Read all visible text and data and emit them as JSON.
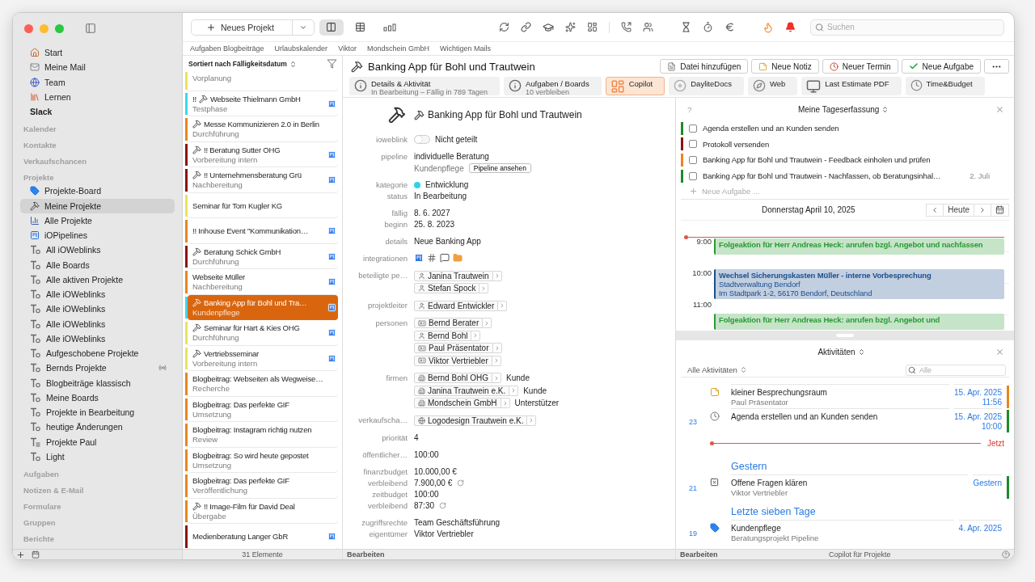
{
  "sidebar": {
    "top_items": [
      {
        "kind": "home",
        "label": "Start"
      },
      {
        "kind": "mail",
        "label": "Meine Mail"
      },
      {
        "kind": "globe",
        "label": "Team"
      },
      {
        "kind": "books",
        "label": "Lernen"
      },
      {
        "kind": "group",
        "label": "Slack"
      }
    ],
    "sections": [
      {
        "title": "Kalender"
      },
      {
        "title": "Kontakte"
      },
      {
        "title": "Verkaufschancen"
      },
      {
        "title": "Projekte",
        "items": [
          {
            "kind": "tag",
            "label": "Projekte-Board",
            "selected": false,
            "shared": false
          },
          {
            "kind": "hammer",
            "label": "Meine Projekte",
            "selected": true,
            "shared": false
          },
          {
            "kind": "chart",
            "label": "Alle Projekte",
            "selected": false,
            "shared": false
          },
          {
            "kind": "pipeline",
            "label": "iOPipelines",
            "selected": false,
            "shared": false
          },
          {
            "kind": "smartlist",
            "label": "All iOWeblinks",
            "selected": false,
            "shared": false
          },
          {
            "kind": "smartlist",
            "label": "Alle Boards",
            "selected": false,
            "shared": false
          },
          {
            "kind": "smartlist",
            "label": "Alle aktiven Projekte",
            "selected": false,
            "shared": false
          },
          {
            "kind": "smartlist",
            "label": "Alle iOWeblinks",
            "selected": false,
            "shared": false
          },
          {
            "kind": "smartlist",
            "label": "Alle iOWeblinks",
            "selected": false,
            "shared": false
          },
          {
            "kind": "smartlist",
            "label": "Alle iOWeblinks",
            "selected": false,
            "shared": false
          },
          {
            "kind": "smartlist",
            "label": "Alle iOWeblinks",
            "selected": false,
            "shared": false
          },
          {
            "kind": "smartlist",
            "label": "Aufgeschobene Projekte",
            "selected": false,
            "shared": false
          },
          {
            "kind": "smartlist",
            "label": "Bernds Projekte",
            "selected": false,
            "shared": true
          },
          {
            "kind": "smartlist",
            "label": "Blogbeiträge klassisch",
            "selected": false,
            "shared": false
          },
          {
            "kind": "smartlist",
            "label": "Meine Boards",
            "selected": false,
            "shared": false
          },
          {
            "kind": "smartlist",
            "label": "Projekte in Bearbeitung",
            "selected": false,
            "shared": false
          },
          {
            "kind": "smartlist",
            "label": "heutige Änderungen",
            "selected": false,
            "shared": false
          },
          {
            "kind": "list",
            "label": "Projekte Paul",
            "selected": false,
            "shared": false
          },
          {
            "kind": "smartlist",
            "label": "Light",
            "selected": false,
            "shared": false
          }
        ]
      },
      {
        "title": "Aufgaben"
      },
      {
        "title": "Notizen & E-Mail"
      },
      {
        "title": "Formulare"
      },
      {
        "title": "Gruppen"
      },
      {
        "title": "Berichte"
      }
    ]
  },
  "toolbar": {
    "new_button": "Neues Projekt",
    "views": [
      {
        "kind": "columns",
        "selected": true
      },
      {
        "kind": "table",
        "selected": false
      },
      {
        "kind": "board",
        "selected": false
      }
    ],
    "search": {
      "placeholder": "Suchen"
    }
  },
  "favorites": [
    "Aufgaben Blogbeiträge",
    "Urlaubskalender",
    "Viktor",
    "Mondschein GmbH",
    "Wichtigen Mails"
  ],
  "list": {
    "sort": "Sortiert nach Fälligkeitsdatum",
    "footer": "31 Elemente",
    "rows": [
      {
        "subtitle": "Vorplanung",
        "color": "#e9e35c",
        "hammer": false,
        "board": false,
        "selected": false
      },
      {
        "prefix": "!!",
        "title": "Webseite Thielmann GmbH",
        "subtitle": "Testphase",
        "color": "#3bd8ea",
        "hammer": true,
        "board": true,
        "selected": false
      },
      {
        "title": "Messe Kommunizieren 2.0 in Berlin",
        "subtitle": "Durchführung",
        "color": "#e8861c",
        "hammer": true,
        "board": false,
        "selected": false
      },
      {
        "title": "!! Beratung Sutter OHG",
        "subtitle": "Vorbereitung intern",
        "color": "#8a1414",
        "hammer": true,
        "board": true,
        "selected": false
      },
      {
        "title": "!! Unternehmensberatung Grü",
        "subtitle": "Nachbereitung",
        "color": "#8a1414",
        "hammer": true,
        "board": true,
        "selected": false
      },
      {
        "title": "Seminar für Tom Kugler KG",
        "color": "#e9e35c",
        "hammer": false,
        "board": false,
        "selected": false
      },
      {
        "title": "!! Inhouse Event \"Kommunikation…",
        "color": "#e8861c",
        "hammer": false,
        "board": true,
        "selected": false
      },
      {
        "title": "Beratung Schick GmbH",
        "subtitle": "Durchführung",
        "color": "#8a1414",
        "hammer": true,
        "board": true,
        "selected": false
      },
      {
        "title": "Webseite Müller",
        "subtitle": "Nachbereitung",
        "color": "#e8861c",
        "hammer": false,
        "board": true,
        "selected": false
      },
      {
        "title": "Banking App für Bohl und Tra…",
        "subtitle": "Kundenpflege",
        "color": "#3bd8ea",
        "hammer": true,
        "board": true,
        "selected": true
      },
      {
        "title": "Seminar für Hart & Kies OHG",
        "subtitle": "Durchführung",
        "color": "#e9e35c",
        "hammer": true,
        "board": true,
        "selected": false
      },
      {
        "title": "Vertriebsseminar",
        "subtitle": "Vorbereitung intern",
        "color": "#e9e35c",
        "hammer": true,
        "board": true,
        "selected": false
      },
      {
        "title": "Blogbeitrag: Webseiten als Wegweise…",
        "subtitle": "Recherche",
        "color": "#e8861c",
        "hammer": false,
        "board": false,
        "selected": false
      },
      {
        "title": "Blogbeitrag: Das perfekte GIF",
        "subtitle": "Umsetzung",
        "color": "#e8861c",
        "hammer": false,
        "board": false,
        "selected": false
      },
      {
        "title": "Blogbeitrag: Instagram richtig nutzen",
        "subtitle": "Review",
        "color": "#e8861c",
        "hammer": false,
        "board": false,
        "selected": false
      },
      {
        "title": "Blogbeitrag: So wird heute gepostet",
        "subtitle": "Umsetzung",
        "color": "#e8861c",
        "hammer": false,
        "board": false,
        "selected": false
      },
      {
        "title": "Blogbeitrag: Das perfekte GIF",
        "subtitle": "Veröffentlichung",
        "color": "#e8861c",
        "hammer": false,
        "board": false,
        "selected": false
      },
      {
        "title": "!! Image-Film für David Deal",
        "subtitle": "Übergabe",
        "color": "#e8861c",
        "hammer": true,
        "board": false,
        "selected": false
      },
      {
        "title": "Medienberatung Langer GbR",
        "color": "#8a1414",
        "hammer": false,
        "board": true,
        "selected": false
      }
    ]
  },
  "project": {
    "title": "Banking App für Bohl und Trautwein",
    "actions": [
      {
        "kind": "file",
        "label": "Datei hinzufügen"
      },
      {
        "kind": "note",
        "label": "Neue Notiz"
      },
      {
        "kind": "event",
        "label": "Neuer Termin"
      },
      {
        "kind": "task",
        "label": "Neue Aufgabe"
      },
      {
        "kind": "more"
      }
    ],
    "tabs": [
      {
        "kind": "info",
        "title": "Details & Aktivität",
        "subtitle": "In Bearbeitung – Fällig in 789 Tagen",
        "selected": false
      },
      {
        "kind": "info",
        "title": "Aufgaben / Boards",
        "subtitle": "10 verbleiben",
        "selected": false
      },
      {
        "kind": "copilot",
        "title": "Copilot",
        "selected": true
      },
      {
        "kind": "docs",
        "title": "DayliteDocs",
        "selected": false
      },
      {
        "kind": "web",
        "title": "Web",
        "selected": false
      },
      {
        "kind": "pdf",
        "title": "Last Estimate PDF",
        "selected": false
      },
      {
        "kind": "time",
        "title": "Time&Budget",
        "selected": false
      }
    ]
  },
  "detail": {
    "heading": "Banking App für Bohl und Trautwein",
    "footer": "Bearbeiten",
    "groups": [
      [
        {
          "kind": "toggle",
          "label": "ioweblink",
          "on": false,
          "value": "Nicht geteilt"
        }
      ],
      [
        {
          "kind": "pipeline",
          "label": "pipeline",
          "value": "individuelle Beratung",
          "sub": "Kundenpflege",
          "button": "Pipeline ansehen"
        }
      ],
      [
        {
          "kind": "category",
          "label": "kategorie",
          "value": "Entwicklung",
          "color": "#2ed3e6"
        },
        {
          "kind": "text",
          "label": "status",
          "value": "In Bearbeitung"
        }
      ],
      [
        {
          "kind": "text",
          "label": "fällig",
          "value": "8. 6. 2027"
        },
        {
          "kind": "text",
          "label": "beginn",
          "value": "25. 8. 2023"
        }
      ],
      [
        {
          "kind": "text",
          "label": "details",
          "value": "Neue Banking App"
        }
      ],
      [
        {
          "kind": "integrations",
          "label": "integrationen"
        }
      ],
      [
        {
          "kind": "chips",
          "label": "beteiligte pe…",
          "chips": [
            {
              "kind": "person",
              "text": "Janina Trautwein"
            },
            {
              "kind": "person",
              "text": "Stefan Spock"
            }
          ]
        }
      ],
      [
        {
          "kind": "chips",
          "label": "projektleiter",
          "chips": [
            {
              "kind": "person",
              "text": "Edward Entwickler"
            }
          ]
        }
      ],
      [
        {
          "kind": "chips",
          "label": "personen",
          "chips": [
            {
              "kind": "card",
              "text": "Bernd Berater"
            },
            {
              "kind": "person",
              "text": "Bernd Bohl"
            },
            {
              "kind": "card",
              "text": "Paul Präsentator"
            },
            {
              "kind": "card",
              "text": "Viktor Vertriebler"
            }
          ]
        }
      ],
      [
        {
          "kind": "chips",
          "label": "firmen",
          "chips": [
            {
              "kind": "company",
              "text": "Bernd Bohl OHG",
              "role": "Kunde"
            },
            {
              "kind": "company",
              "text": "Janina Trautwein e.K.",
              "role": "Kunde"
            },
            {
              "kind": "company",
              "text": "Mondschein GmbH",
              "role": "Unterstützer"
            }
          ]
        }
      ],
      [
        {
          "kind": "chips",
          "label": "verkaufscha…",
          "chips": [
            {
              "kind": "opportunity",
              "text": "Logodesign Trautwein e.K."
            }
          ]
        }
      ],
      [
        {
          "kind": "text",
          "label": "priorität",
          "value": "4"
        }
      ],
      [
        {
          "kind": "text",
          "label": "öffentlicher…",
          "value": "100:00"
        }
      ],
      [
        {
          "kind": "text",
          "label": "finanzbudget",
          "value": "10.000,00 €"
        },
        {
          "kind": "remaining",
          "label": "verbleibend",
          "value": "7.900,00 €"
        },
        {
          "kind": "text",
          "label": "zeitbudget",
          "value": "100:00"
        },
        {
          "kind": "remaining",
          "label": "verbleibend",
          "value": "87:30"
        }
      ],
      [
        {
          "kind": "text",
          "label": "zugriffsrechte",
          "value": "Team Geschäftsführung"
        },
        {
          "kind": "text",
          "label": "eigentümer",
          "value": "Viktor Vertriebler"
        }
      ]
    ]
  },
  "day_summary": {
    "help": "?",
    "title": "Meine Tageserfassung",
    "add": "Neue Aufgabe …",
    "tasks": [
      {
        "text": "Agenda erstellen und an Kunden senden",
        "color": "#1e8a2a",
        "checked": false
      },
      {
        "text": "Protokoll versenden",
        "color": "#8a1414",
        "checked": false
      },
      {
        "text": "Banking App für Bohl und Trautwein - Feedback einholen und prüfen",
        "color": "#e8861c",
        "checked": false
      },
      {
        "text": "Banking App für Bohl und Trautwein - Nachfassen, ob Beratungsinhal…",
        "date": "2. Juli",
        "color": "#1e8a2a",
        "checked": false
      }
    ]
  },
  "calendar": {
    "date": "Donnerstag April 10, 2025",
    "today": "Heute",
    "hours": [
      "9:00",
      "10:00",
      "11:00"
    ],
    "events": [
      {
        "lines": [
          "Folgeaktion für Herr Andreas Heck: anrufen bzgl. Angebot und nachfassen"
        ],
        "color": "#2a9a34"
      },
      {
        "lines": [
          "Wechsel Sicherungskasten Müller - interne Vorbesprechung",
          "Stadtverwaltung Bendorf",
          "Im Stadtpark 1-2, 56170 Bendorf, Deutschland"
        ],
        "color": "#1d4f8e"
      },
      {
        "lines": [
          "Folgeaktion für Herr Andreas Heck: anrufen bzgl. Angebot und"
        ],
        "color": "#2a9a34"
      }
    ]
  },
  "activities": {
    "title": "Aktivitäten",
    "filter": "Alle Aktivitäten",
    "search": {
      "placeholder": "Alle"
    },
    "entries": [
      {
        "kind": "note",
        "title": "kleiner Besprechungsraum",
        "subtitle": "Paul Präsentator",
        "date": "15. Apr. 2025",
        "time": "11:56",
        "color": "#e8861c"
      },
      {
        "kind": "clock",
        "day": "23",
        "title": "Agenda erstellen und an Kunden senden",
        "date": "15. Apr. 2025",
        "time": "10:00",
        "color": "#1e8a2a"
      },
      {
        "kind": "now",
        "label": "Jetzt"
      },
      {
        "kind": "heading",
        "label": "Gestern"
      },
      {
        "kind": "cross",
        "day": "21",
        "title": "Offene Fragen klären",
        "subtitle": "Viktor Vertriebler",
        "date": "Gestern",
        "color": "#1e8a2a"
      },
      {
        "kind": "heading",
        "label": "Letzte sieben Tage"
      },
      {
        "kind": "tag",
        "day": "19",
        "title": "Kundenpflege",
        "subtitle": "Beratungsprojekt Pipeline",
        "date": "4. Apr. 2025"
      }
    ]
  },
  "footer": {
    "left": "Bearbeiten",
    "center": "Copilot für Projekte"
  }
}
